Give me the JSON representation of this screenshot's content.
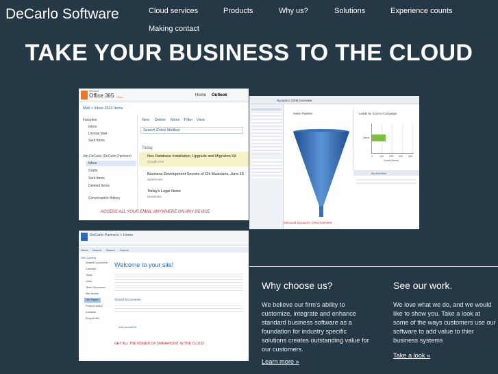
{
  "header": {
    "brand": "DeCarlo Software",
    "nav": [
      {
        "label": "Cloud services"
      },
      {
        "label": "Products"
      },
      {
        "label": "Why us?"
      },
      {
        "label": "Solutions"
      },
      {
        "label": "Experience counts"
      },
      {
        "label": "Making contact"
      }
    ]
  },
  "hero": {
    "headline": "TAKE YOUR BUSINESS TO THE CLOUD"
  },
  "screenshots": {
    "office365": {
      "logo_prefix": "Microsoft",
      "logo": "Office 365",
      "logo_suffix": "Beta",
      "tabs": [
        "Home",
        "Outlook"
      ],
      "mail_header": "Mail > Inbox 1522 Items",
      "toolbar": [
        "New",
        "Delete",
        "Move",
        "Filter",
        "View"
      ],
      "search_placeholder": "Search Entire Mailbox",
      "folders_a": [
        "Favorites",
        "Inbox",
        "Unread Mail",
        "Sent Items"
      ],
      "folders_b": [
        "Jim DeCarlo (DeCarlo Partners)",
        "Inbox",
        "Drafts",
        "Sent Items",
        "Deleted Items",
        "Conversation History"
      ],
      "section_today": "Today",
      "messages": [
        {
          "subject": "Nos Database Installation, Upgrade and Migration Kit",
          "from": "Google.com"
        },
        {
          "subject": "Business Development Secrets of Chi Musicians, June 15",
          "from": "Sparknotes"
        },
        {
          "subject": "Today's Legal News",
          "from": "Newsletter"
        }
      ],
      "caption": "ACCESS ALL YOUR EMAIL ANYWHERE ON ANY DEVICE"
    },
    "dynamics": {
      "title": "Dynamics CRM Overview",
      "left_chart_title": "Sales Pipeline",
      "right_chart_title": "Leads by Source Campaign",
      "bar_category": "Direct",
      "axis_label": "Count (Name)",
      "ticks": [
        "0",
        "100",
        "200",
        "300",
        "400"
      ],
      "activities_title": "My Activities",
      "caption": "Microsoft Dynamics CRM Overview"
    },
    "sharepoint": {
      "site_name": "DeCarlo Partners > Home",
      "nav": [
        "Home",
        "Search",
        "Search",
        "Search"
      ],
      "sidebar_title": "Site Content",
      "sidebar_items": [
        "Shared Documents",
        "Calendar",
        "Tasks",
        "Links",
        "Team Discussion",
        "Site Assets",
        "Site Pages",
        "Project Library",
        "Contacts",
        "Recycle Bin"
      ],
      "welcome": "Welcome to your site!",
      "shared_docs": "Shared Documents",
      "add_document": "Add document",
      "caption": "GET ALL THE POWER OF SHAREPOINT IN THE CLOUD"
    }
  },
  "why": {
    "heading": "Why choose us?",
    "body": "We believe our firm's ability to customize, integrate and enhance standard business software as a foundation for industry specific solutions creates outstanding value for our customers.",
    "link": "Learn more »"
  },
  "see": {
    "heading": "See our work.",
    "body": "We love what we do, and we would like to show you. Take a look at some of the ways customers use our software to add value to thier business systems",
    "link": "Take a look »"
  },
  "colors": {
    "page_background": "#253845",
    "text": "#ffffff",
    "caption_red": "#d0232a",
    "funnel_blue": "#3b6fb6",
    "bar_green": "#7fbf3f"
  }
}
